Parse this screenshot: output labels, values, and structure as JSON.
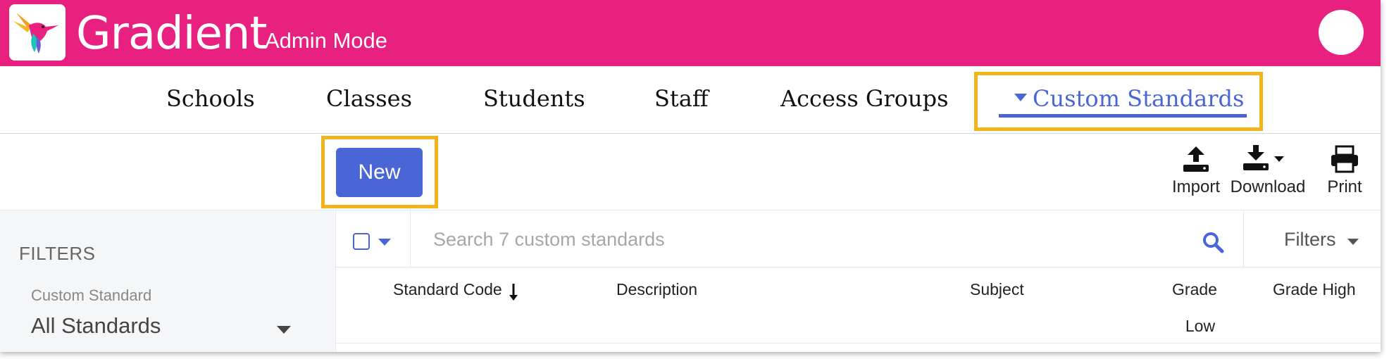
{
  "header": {
    "brand": "Gradient",
    "mode": "Admin Mode",
    "colors": {
      "background": "#e8207f",
      "text": "#ffffff"
    }
  },
  "nav": {
    "items": [
      {
        "label": "Schools"
      },
      {
        "label": "Classes"
      },
      {
        "label": "Students"
      },
      {
        "label": "Staff"
      },
      {
        "label": "Access Groups"
      },
      {
        "label": "Custom Standards",
        "active": true
      }
    ],
    "accent": "#4a66d6",
    "highlight": "#f3b31d"
  },
  "toolbar": {
    "new_label": "New",
    "import_label": "Import",
    "download_label": "Download",
    "print_label": "Print"
  },
  "sidebar": {
    "title": "FILTERS",
    "custom_standard_label": "Custom Standard",
    "custom_standard_value": "All Standards"
  },
  "table": {
    "search_placeholder": "Search 7 custom standards",
    "filters_label": "Filters",
    "columns": {
      "standard_code": "Standard Code",
      "description": "Description",
      "subject": "Subject",
      "grade_low_1": "Grade",
      "grade_low_2": "Low",
      "grade_high": "Grade High"
    },
    "sort_icon": "arrow-down-icon"
  }
}
